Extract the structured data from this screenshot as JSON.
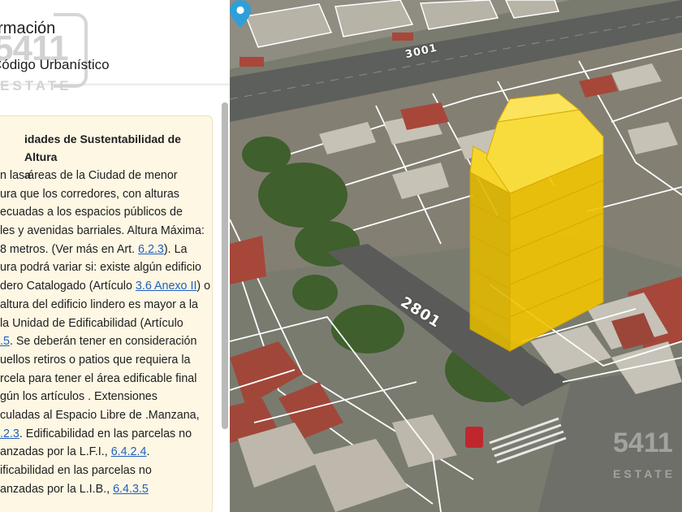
{
  "panel": {
    "title": "ormación",
    "subtitle": "Código Urbanístico",
    "logo": {
      "number": "5411",
      "word": "ESTATE"
    },
    "card": {
      "heading": "idades de Sustentabilidad de Altura\na",
      "lines": [
        [
          {
            "t": "n las áreas de la Ciudad de menor"
          }
        ],
        [
          {
            "t": "ura que los corredores, con alturas"
          }
        ],
        [
          {
            "t": "ecuadas a los espacios públicos de"
          }
        ],
        [
          {
            "t": "les y avenidas barriales. Altura Máxima:"
          }
        ],
        [
          {
            "t": "8 metros. (Ver más en Art. "
          },
          {
            "t": "6.2.3",
            "link": true
          },
          {
            "t": "). La"
          }
        ],
        [
          {
            "t": "ura podrá variar si: existe algún edificio"
          }
        ],
        [
          {
            "t": "dero Catalogado (Artículo "
          },
          {
            "t": "3.6 Anexo II",
            "link": true
          },
          {
            "t": ") o"
          }
        ],
        [
          {
            "t": "altura del edificio lindero es mayor a la"
          }
        ],
        [
          {
            "t": "la Unidad de Edificabilidad (Artículo"
          }
        ],
        [
          {
            "t": ".5",
            "link": true
          },
          {
            "t": ". Se deberán tener en consideración"
          }
        ],
        [
          {
            "t": "uellos retiros o patios que requiera la"
          }
        ],
        [
          {
            "t": "rcela para tener el área edificable final"
          }
        ],
        [
          {
            "t": "gún los artículos . Extensiones"
          }
        ],
        [
          {
            "t": "culadas al Espacio Libre de .Manzana,"
          }
        ],
        [
          {
            "t": ".2.3",
            "link": true
          },
          {
            "t": ". Edificabilidad en las parcelas no"
          }
        ],
        [
          {
            "t": "anzadas por la L.F.I., "
          },
          {
            "t": "6.4.2.4",
            "link": true
          },
          {
            "t": "."
          }
        ],
        [
          {
            "t": "ificabilidad en las parcelas no"
          }
        ],
        [
          {
            "t": "anzadas por la L.I.B., "
          },
          {
            "t": "6.4.3.5",
            "link": true
          }
        ]
      ]
    }
  },
  "map": {
    "street_labels": {
      "top": "3001",
      "middle": "2801"
    },
    "watermark": {
      "number": "5411",
      "word": "ESTATE"
    },
    "colors": {
      "building": "#f2c500",
      "pin": "#2e9fd8",
      "lot_lines": "#ffffff"
    }
  }
}
